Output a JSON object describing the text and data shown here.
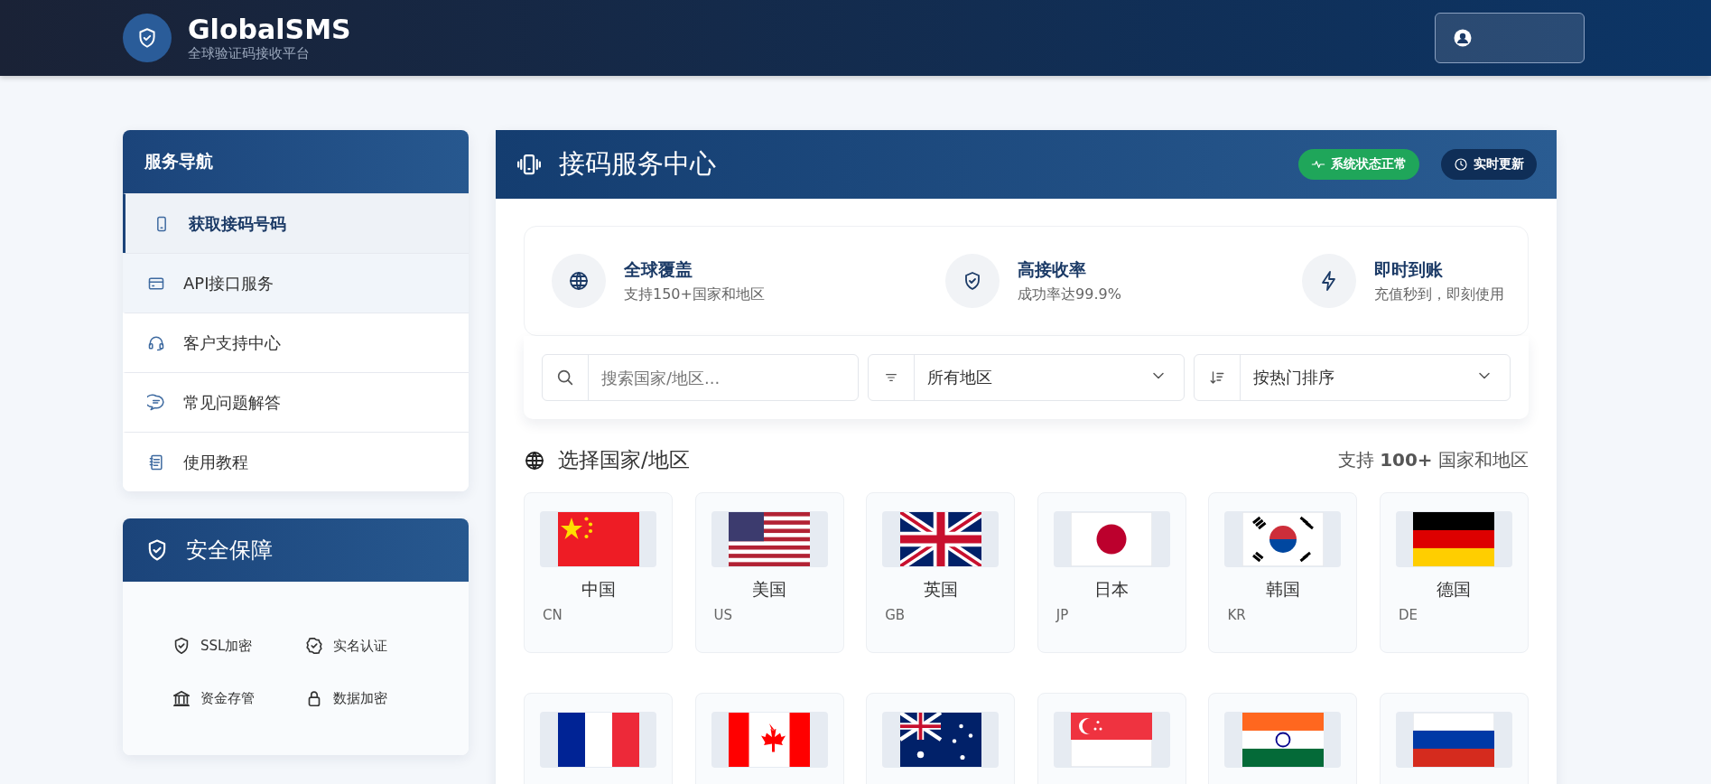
{
  "header": {
    "title": "GlobalSMS",
    "subtitle": "全球验证码接收平台"
  },
  "nav": {
    "title": "服务导航",
    "items": [
      {
        "label": "获取接码号码",
        "selected": true,
        "hovered": false
      },
      {
        "label": "API接口服务",
        "selected": false,
        "hovered": true
      },
      {
        "label": "客户支持中心",
        "selected": false,
        "hovered": false
      },
      {
        "label": "常见问题解答",
        "selected": false,
        "hovered": false
      },
      {
        "label": "使用教程",
        "selected": false,
        "hovered": false
      }
    ]
  },
  "security": {
    "title": "安全保障",
    "items": [
      {
        "label": "SSL加密"
      },
      {
        "label": "实名认证"
      },
      {
        "label": "资金存管"
      },
      {
        "label": "数据加密"
      }
    ]
  },
  "main": {
    "title": "接码服务中心",
    "badges": [
      {
        "label": "系统状态正常",
        "kind": "status"
      },
      {
        "label": "实时更新",
        "kind": "live"
      }
    ]
  },
  "features": [
    {
      "title": "全球覆盖",
      "subtitle": "支持150+国家和地区"
    },
    {
      "title": "高接收率",
      "subtitle": "成功率达99.9%"
    },
    {
      "title": "即时到账",
      "subtitle": "充值秒到，即刻使用"
    }
  ],
  "filters": {
    "search": {
      "placeholder": "搜索国家/地区..."
    },
    "region": {
      "value": "所有地区"
    },
    "sort": {
      "value": "按热门排序"
    }
  },
  "countries_section": {
    "title": "选择国家/地区",
    "note": "支持 **100+** 国家和地区"
  },
  "countries": [
    {
      "kind": "cn",
      "name": "中国",
      "code": "CN"
    },
    {
      "kind": "us",
      "name": "美国",
      "code": "US"
    },
    {
      "kind": "gb",
      "name": "英国",
      "code": "GB"
    },
    {
      "kind": "jp",
      "name": "日本",
      "code": "JP"
    },
    {
      "kind": "kr",
      "name": "韩国",
      "code": "KR"
    },
    {
      "kind": "de",
      "name": "德国",
      "code": "DE"
    },
    {
      "kind": "fr"
    },
    {
      "kind": "ca"
    },
    {
      "kind": "au"
    },
    {
      "kind": "sg"
    },
    {
      "kind": "in"
    },
    {
      "kind": "ru"
    }
  ]
}
